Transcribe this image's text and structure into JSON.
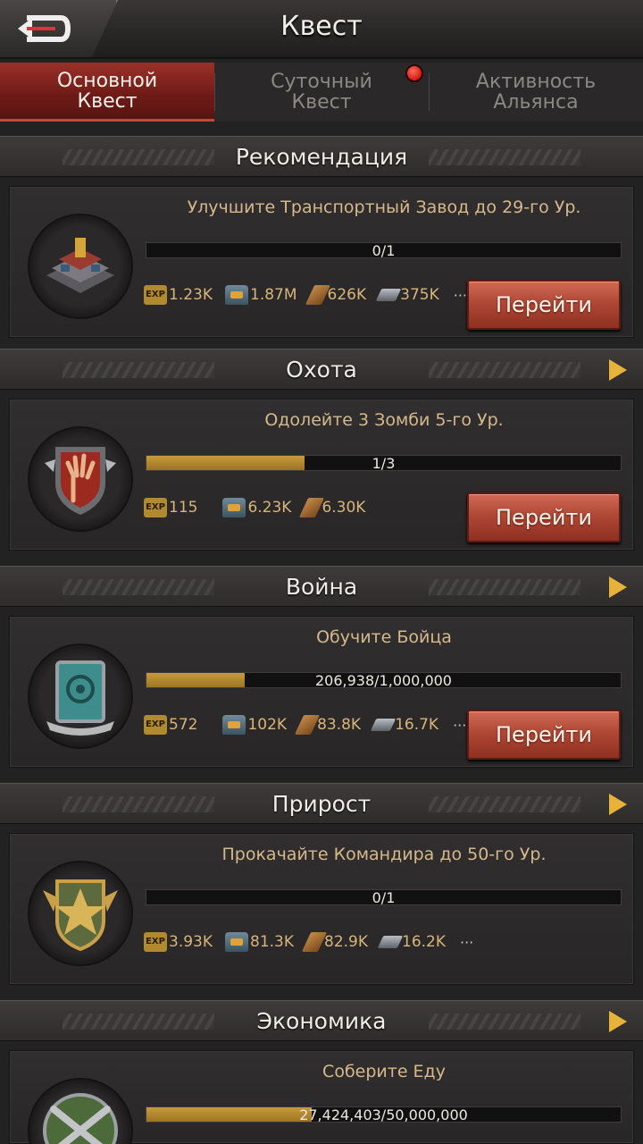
{
  "header": {
    "title": "Квест",
    "back_icon": "back-arrow-icon"
  },
  "tabs": [
    {
      "label": "Основной\nКвест",
      "active": true
    },
    {
      "label": "Суточный\nКвест",
      "active": false,
      "badge": true
    },
    {
      "label": "Активность\nАльянса",
      "active": false
    }
  ],
  "sections": [
    {
      "title": "Рекомендация",
      "quest": {
        "title": "Улучшите Транспортный Завод до 29-го Ур.",
        "progress_text": "0/1",
        "progress": 0,
        "rewards": [
          "1.23K",
          "1.87M",
          "626K",
          "375K"
        ],
        "more": "···",
        "button": "Перейти",
        "icon": "factory-icon"
      }
    },
    {
      "title": "Охота",
      "quest": {
        "title": "Одолейте 3 Зомби 5-го Ур.",
        "progress_text": "1/3",
        "progress": 0.3333,
        "rewards": [
          "115",
          "6.23K",
          "6.30K"
        ],
        "button": "Перейти",
        "icon": "zombie-hand-shield-icon"
      }
    },
    {
      "title": "Война",
      "quest": {
        "title": "Обучите Бойца",
        "progress_text": "206,938/1,000,000",
        "progress": 0.2069,
        "rewards": [
          "572",
          "102K",
          "83.8K",
          "16.7K"
        ],
        "more": "···",
        "button": "Перейти",
        "icon": "target-shield-icon"
      }
    },
    {
      "title": "Прирост",
      "quest": {
        "title": "Прокачайте Командира до 50-го Ур.",
        "progress_text": "0/1",
        "progress": 0,
        "rewards": [
          "3.93K",
          "81.3K",
          "82.9K",
          "16.2K"
        ],
        "more": "···",
        "icon": "star-medal-icon"
      }
    },
    {
      "title": "Экономика",
      "quest": {
        "title": "Соберите Еду",
        "progress_text": "27,424,403/50,000,000",
        "progress": 0.3491,
        "icon": "crossed-guns-icon"
      }
    }
  ],
  "colors": {
    "accent": "#e6b23a",
    "button": "#b04836",
    "tab_active": "#8a2620"
  }
}
